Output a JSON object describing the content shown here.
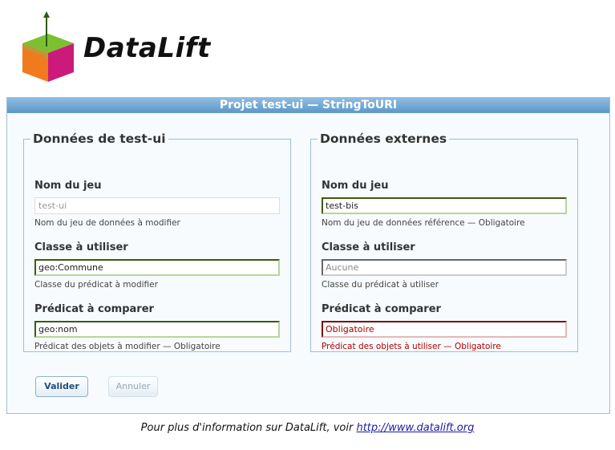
{
  "logo": {
    "brand": "DataLift"
  },
  "panel": {
    "title": "Projet test-ui — StringToURI"
  },
  "left": {
    "legend": "Données de test-ui",
    "dataset": {
      "label": "Nom du jeu",
      "value": "test-ui",
      "hint": "Nom du jeu de données à modifier"
    },
    "class": {
      "label": "Classe à utiliser",
      "value": "geo:Commune",
      "hint": "Classe du prédicat à modifier"
    },
    "predicate": {
      "label": "Prédicat à comparer",
      "value": "geo:nom",
      "hint": "Prédicat des objets à modifier — Obligatoire"
    }
  },
  "right": {
    "legend": "Données externes",
    "dataset": {
      "label": "Nom du jeu",
      "value": "test-bis",
      "hint": "Nom du jeu de données référence — Obligatoire"
    },
    "class": {
      "label": "Classe à utiliser",
      "value": "Aucune",
      "hint": "Classe du prédicat à utiliser"
    },
    "predicate": {
      "label": "Prédicat à comparer",
      "value": "Obligatoire",
      "hint": "Prédicat des objets à utiliser — Obligatoire"
    }
  },
  "buttons": {
    "submit": "Valider",
    "cancel": "Annuler"
  },
  "footer": {
    "text": "Pour plus d'information sur DataLift, voir ",
    "link": "http://www.datalift.org"
  }
}
